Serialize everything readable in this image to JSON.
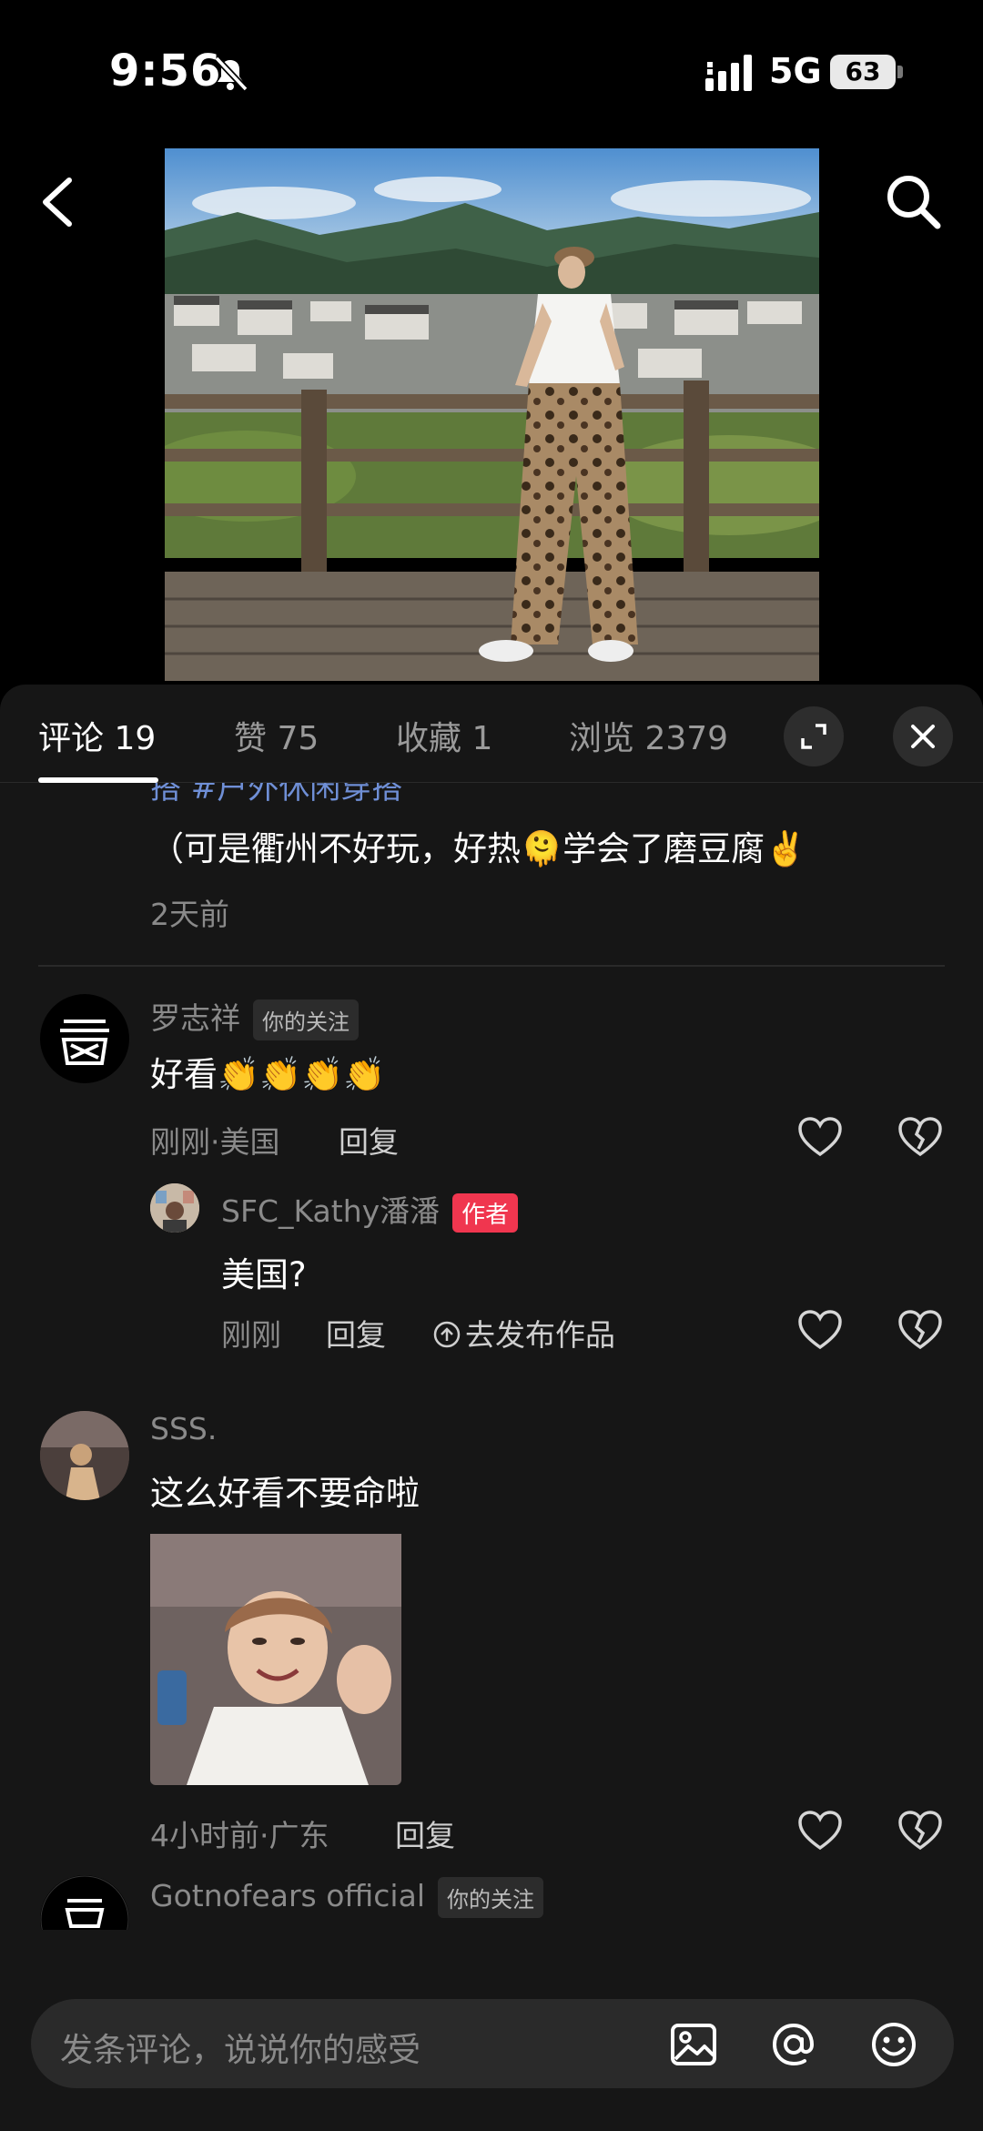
{
  "status": {
    "time": "9:56",
    "network": "5G",
    "battery": "63"
  },
  "tabs": [
    {
      "label": "评论 19"
    },
    {
      "label": "赞 75"
    },
    {
      "label": "收藏 1"
    },
    {
      "label": "浏览 2379"
    }
  ],
  "prev_comment": {
    "hashtag": "搭 #户外休闲穿搭",
    "text": "（可是衢州不好玩，好热🫠学会了磨豆腐✌️",
    "time": "2天前"
  },
  "comments": [
    {
      "name": "罗志祥",
      "badge": "你的关注",
      "text": "好看👏👏👏👏",
      "meta": "刚刚·美国",
      "reply": "回复",
      "replies": [
        {
          "name": "SFC_Kathy潘潘",
          "badge": "作者",
          "text": "美国?",
          "meta": "刚刚",
          "reply": "回复",
          "publish": "去发布作品"
        }
      ]
    },
    {
      "name": "SSS.",
      "text": "这么好看不要命啦",
      "meta": "4小时前·广东",
      "reply": "回复"
    },
    {
      "name": "Gotnofears official",
      "badge": "你的关注"
    }
  ],
  "input": {
    "placeholder": "发条评论，说说你的感受"
  }
}
